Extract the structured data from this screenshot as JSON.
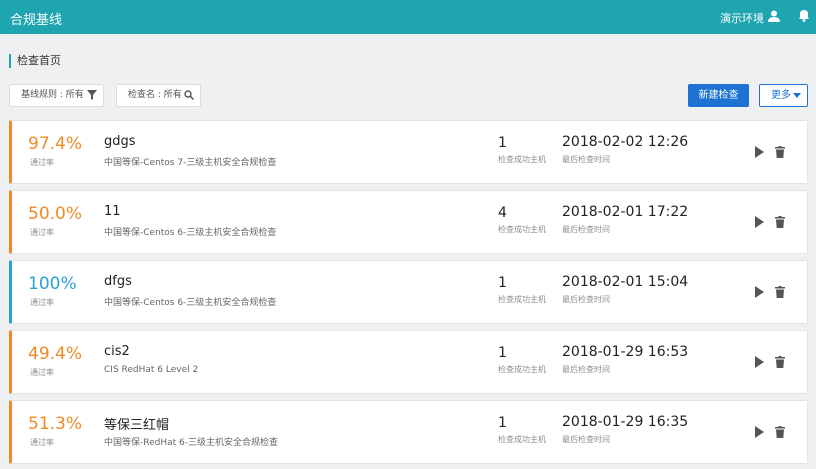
{
  "header": {
    "app_title": "合规基线",
    "environment": "演示环境",
    "user_icon": "user-icon",
    "notification_icon": "bell-icon"
  },
  "page": {
    "title": "检查首页"
  },
  "toolbar": {
    "rule_filter": "基线规则 : 所有",
    "name_filter": "检查名 : 所有",
    "new_button": "新建检查",
    "more_button": "更多"
  },
  "labels": {
    "rate": "通过率",
    "hosts": "检查成功主机",
    "time": "最后检查时间"
  },
  "colors": {
    "accent": "#1fa5b0",
    "primary": "#1d72d4",
    "orange": "#f08a24",
    "blue": "#2aa0d8"
  },
  "checks": [
    {
      "rate": "97.4%",
      "name": "gdgs",
      "desc": "中国等保-Centos 7-三级主机安全合规检查",
      "hosts": "1",
      "time": "2018-02-02 12:26"
    },
    {
      "rate": "50.0%",
      "name": "11",
      "desc": "中国等保-Centos 6-三级主机安全合规检查",
      "hosts": "4",
      "time": "2018-02-01 17:22"
    },
    {
      "rate": "100%",
      "name": "dfgs",
      "desc": "中国等保-Centos 6-三级主机安全合规检查",
      "hosts": "1",
      "time": "2018-02-01 15:04"
    },
    {
      "rate": "49.4%",
      "name": "cis2",
      "desc": "CIS RedHat 6 Level 2",
      "hosts": "1",
      "time": "2018-01-29 16:53"
    },
    {
      "rate": "51.3%",
      "name": "等保三红帽",
      "desc": "中国等保-RedHat 6-三级主机安全合规检查",
      "hosts": "1",
      "time": "2018-01-29 16:35"
    }
  ]
}
